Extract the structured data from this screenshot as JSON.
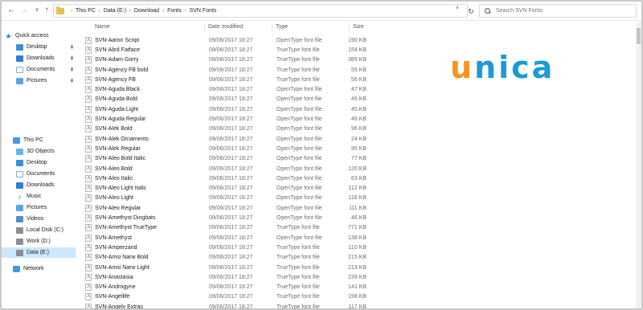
{
  "address_bar": {
    "breadcrumb": [
      "This PC",
      "Data (E:)",
      "Download",
      "Fonts",
      "SVN Fonts"
    ],
    "search_placeholder": "Search SVN Fonts"
  },
  "nav": {
    "quick_access": {
      "label": "Quick access",
      "items": [
        {
          "label": "Desktop",
          "icon": "desktop-icon"
        },
        {
          "label": "Downloads",
          "icon": "downloads-icon"
        },
        {
          "label": "Documents",
          "icon": "documents-icon"
        },
        {
          "label": "Pictures",
          "icon": "pictures-icon"
        }
      ]
    },
    "this_pc": {
      "label": "This PC",
      "items": [
        {
          "label": "3D Objects",
          "icon": "3d-objects-icon"
        },
        {
          "label": "Desktop",
          "icon": "desktop-icon"
        },
        {
          "label": "Documents",
          "icon": "documents-icon"
        },
        {
          "label": "Downloads",
          "icon": "downloads-icon"
        },
        {
          "label": "Music",
          "icon": "music-icon"
        },
        {
          "label": "Pictures",
          "icon": "pictures-icon"
        },
        {
          "label": "Videos",
          "icon": "videos-icon"
        },
        {
          "label": "Local Disk (C:)",
          "icon": "disk-icon"
        },
        {
          "label": "Work (D:)",
          "icon": "disk-icon"
        },
        {
          "label": "Data (E:)",
          "icon": "disk-icon",
          "selected": true
        }
      ]
    },
    "network": {
      "label": "Network"
    }
  },
  "columns": {
    "name": "Name",
    "date": "Date modified",
    "type": "Type",
    "size": "Size"
  },
  "files": [
    {
      "name": "SVN-Aaron Script",
      "date": "09/06/2017 18:27",
      "type": "OpenType font file",
      "size": "190 KB"
    },
    {
      "name": "SVN-Abril Fatface",
      "date": "09/06/2017 18:27",
      "type": "TrueType font file",
      "size": "154 KB"
    },
    {
      "name": "SVN-Adam Gorry",
      "date": "09/06/2017 18:27",
      "type": "TrueType font file",
      "size": "389 KB"
    },
    {
      "name": "SVN-Agency FB bold",
      "date": "09/06/2017 18:27",
      "type": "TrueType font file",
      "size": "55 KB"
    },
    {
      "name": "SVN-Agency FB",
      "date": "09/06/2017 18:27",
      "type": "TrueType font file",
      "size": "56 KB"
    },
    {
      "name": "SVN-Aguda Black",
      "date": "09/06/2017 18:27",
      "type": "OpenType font file",
      "size": "47 KB"
    },
    {
      "name": "SVN-Aguda Bold",
      "date": "09/06/2017 18:27",
      "type": "OpenType font file",
      "size": "46 KB"
    },
    {
      "name": "SVN-Aguda Light",
      "date": "09/06/2017 18:27",
      "type": "OpenType font file",
      "size": "45 KB"
    },
    {
      "name": "SVN-Aguda Regular",
      "date": "09/06/2017 18:27",
      "type": "OpenType font file",
      "size": "46 KB"
    },
    {
      "name": "SVN-Alek Bold",
      "date": "09/06/2017 18:27",
      "type": "OpenType font file",
      "size": "96 KB"
    },
    {
      "name": "SVN-Alek Ornaments",
      "date": "09/06/2017 18:27",
      "type": "OpenType font file",
      "size": "24 KB"
    },
    {
      "name": "SVN-Alek Regular",
      "date": "09/06/2017 18:27",
      "type": "OpenType font file",
      "size": "95 KB"
    },
    {
      "name": "SVN-Aleo Bold Italic",
      "date": "09/06/2017 18:27",
      "type": "OpenType font file",
      "size": "77 KB"
    },
    {
      "name": "SVN-Aleo Bold",
      "date": "09/06/2017 18:27",
      "type": "OpenType font file",
      "size": "120 KB"
    },
    {
      "name": "SVN-Aleo Italic",
      "date": "09/06/2017 18:27",
      "type": "OpenType font file",
      "size": "63 KB"
    },
    {
      "name": "SVN-Aleo Light Italic",
      "date": "09/06/2017 18:27",
      "type": "OpenType font file",
      "size": "112 KB"
    },
    {
      "name": "SVN-Aleo Light",
      "date": "09/06/2017 18:27",
      "type": "OpenType font file",
      "size": "116 KB"
    },
    {
      "name": "SVN-Aleo Regular",
      "date": "09/06/2017 18:27",
      "type": "OpenType font file",
      "size": "111 KB"
    },
    {
      "name": "SVN-Amethyst Dingbats",
      "date": "09/06/2017 18:27",
      "type": "OpenType font file",
      "size": "46 KB"
    },
    {
      "name": "SVN-Amethyst TrueType",
      "date": "09/06/2017 18:27",
      "type": "TrueType font file",
      "size": "771 KB"
    },
    {
      "name": "SVN-Amethyst",
      "date": "09/06/2017 18:27",
      "type": "OpenType font file",
      "size": "138 KB"
    },
    {
      "name": "SVN-Amperzand",
      "date": "09/06/2017 18:27",
      "type": "TrueType font file",
      "size": "110 KB"
    },
    {
      "name": "SVN-Amsi Narw Bold",
      "date": "09/06/2017 18:27",
      "type": "TrueType font file",
      "size": "215 KB"
    },
    {
      "name": "SVN-Amsi Narw Light",
      "date": "09/06/2017 18:27",
      "type": "TrueType font file",
      "size": "219 KB"
    },
    {
      "name": "SVN-Anastasia",
      "date": "09/06/2017 18:27",
      "type": "TrueType font file",
      "size": "239 KB"
    },
    {
      "name": "SVN-Androgyne",
      "date": "09/06/2017 18:27",
      "type": "TrueType font file",
      "size": "141 KB"
    },
    {
      "name": "SVN-Angellife",
      "date": "09/06/2017 18:27",
      "type": "TrueType font file",
      "size": "198 KB"
    },
    {
      "name": "SVN-Angely Extras",
      "date": "09/06/2017 18:27",
      "type": "TrueType font file",
      "size": "117 KB"
    }
  ],
  "brand": {
    "part1": "u",
    "part2": "nica"
  },
  "colors": {
    "selection": "#cce8ff",
    "brand_orange": "#f7941d",
    "brand_blue": "#1b9ad6",
    "folder": "#e8c055"
  }
}
